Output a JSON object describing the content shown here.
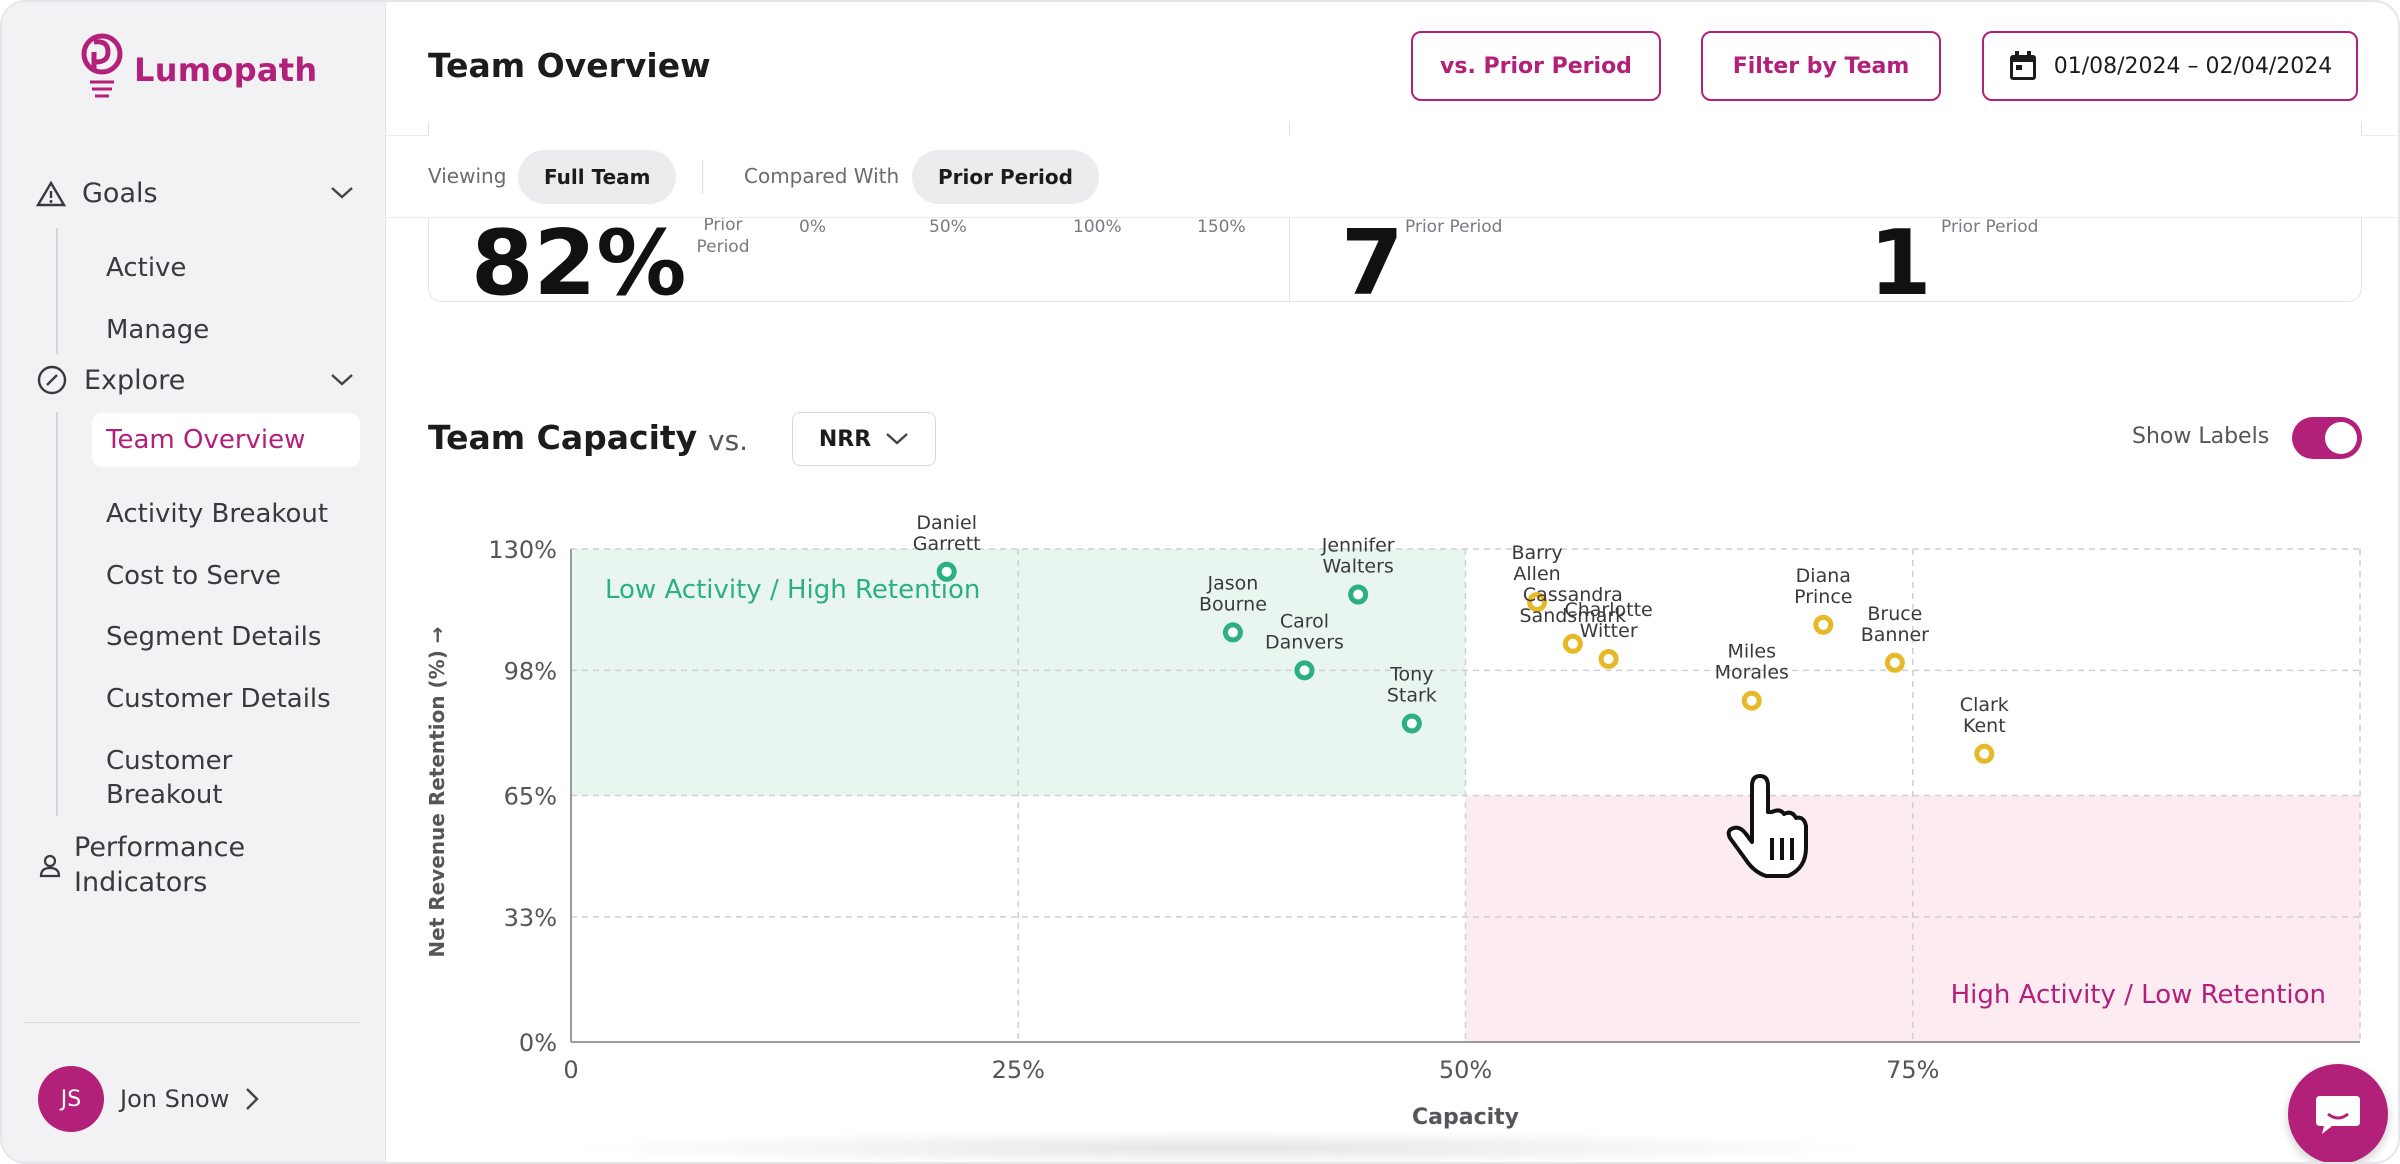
{
  "app": {
    "name": "Lumopath",
    "brand_color": "#b3207a"
  },
  "sidebar": {
    "sections": [
      {
        "label": "Goals",
        "icon": "warning-triangle-icon",
        "items": [
          "Active",
          "Manage"
        ]
      },
      {
        "label": "Explore",
        "icon": "compass-icon",
        "items": [
          "Team Overview",
          "Activity Breakout",
          "Cost to Serve",
          "Segment Details",
          "Customer Details",
          "Customer Breakout"
        ]
      }
    ],
    "performance": "Performance Indicators",
    "active_item": "Team Overview",
    "user": {
      "initials": "JS",
      "name": "Jon Snow"
    }
  },
  "header": {
    "title": "Team Overview",
    "btn_prior": "vs. Prior Period",
    "btn_filter": "Filter by Team",
    "date_range": "01/08/2024 – 02/04/2024"
  },
  "subheader": {
    "viewing_label": "Viewing",
    "viewing_value": "Full Team",
    "compared_label": "Compared With",
    "compared_value": "Prior Period"
  },
  "cards": {
    "card1_prior": "Prior Period",
    "card1_ticks": [
      "0%",
      "50%",
      "100%",
      "150%"
    ],
    "card2_prior": "Prior Period",
    "card3_prior": "Prior Period"
  },
  "capacity": {
    "title": "Team Capacity",
    "vs": "vs.",
    "metric": "NRR",
    "show_labels": "Show Labels",
    "show_labels_on": true
  },
  "chart_data": {
    "type": "scatter",
    "xlabel": "Capacity",
    "ylabel": "Net Revenue Retention (%) →",
    "x_ticks": [
      "0",
      "25%",
      "50%",
      "75%"
    ],
    "y_ticks": [
      "130%",
      "98%",
      "65%",
      "33%",
      "0%"
    ],
    "xlim": [
      0,
      100
    ],
    "ylim": [
      0,
      130
    ],
    "quadrants": [
      {
        "label": "Low Activity / High Retention",
        "color": "#2bb07f"
      },
      {
        "label": "High Activity / Low Retention",
        "color": "#b3207a"
      }
    ],
    "series": [
      {
        "color": "#2bb07f",
        "points": [
          {
            "name": "Daniel Garrett",
            "x": 21,
            "y": 124
          },
          {
            "name": "Jason Bourne",
            "x": 37,
            "y": 108
          },
          {
            "name": "Carol Danvers",
            "x": 41,
            "y": 98
          },
          {
            "name": "Jennifer Walters",
            "x": 44,
            "y": 118
          },
          {
            "name": "Tony Stark",
            "x": 47,
            "y": 84
          }
        ]
      },
      {
        "color": "#e8b927",
        "points": [
          {
            "name": "Barry Allen",
            "x": 54,
            "y": 116
          },
          {
            "name": "Cassandra Sandsmark",
            "x": 56,
            "y": 105
          },
          {
            "name": "Charlotte Witter",
            "x": 58,
            "y": 101
          },
          {
            "name": "Miles Morales",
            "x": 66,
            "y": 90
          },
          {
            "name": "Diana Prince",
            "x": 70,
            "y": 110
          },
          {
            "name": "Bruce Banner",
            "x": 74,
            "y": 100
          },
          {
            "name": "Clark Kent",
            "x": 79,
            "y": 76
          }
        ]
      }
    ]
  },
  "icons": {
    "logo": "bulb-logo-icon",
    "calendar": "calendar-icon",
    "chat": "chat-icon",
    "cursor": "hand-cursor-icon"
  }
}
